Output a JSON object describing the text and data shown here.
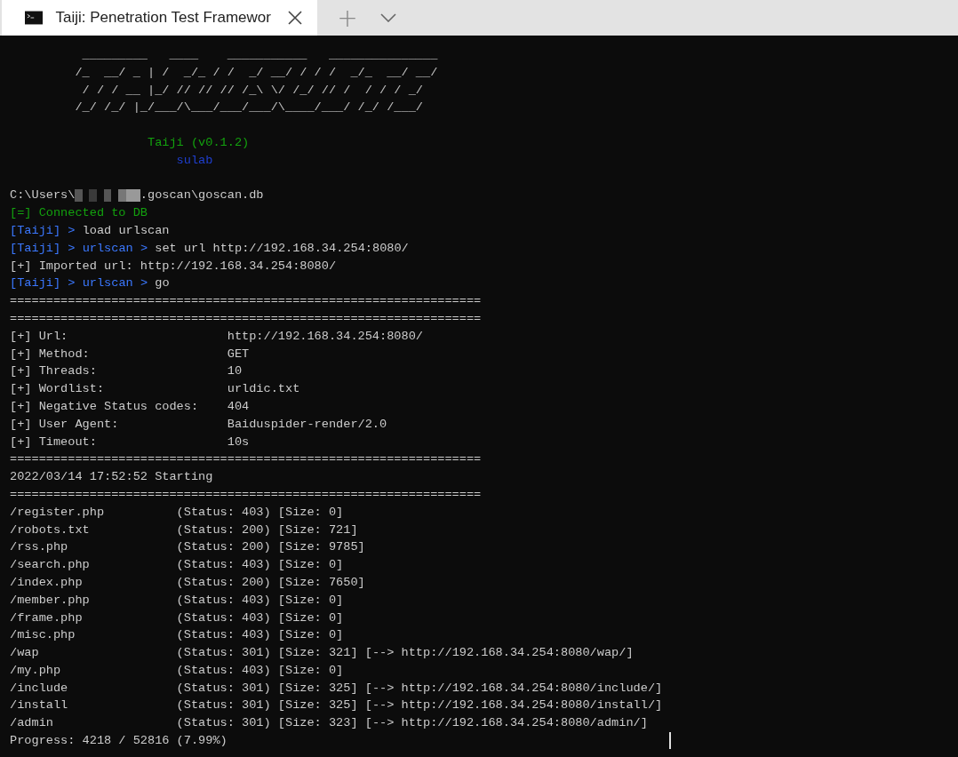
{
  "window": {
    "tabs": [
      {
        "title": "Taiji: Penetration Test Framewor",
        "selected": true
      }
    ],
    "new_tab": "+"
  },
  "terminal": {
    "lines": [
      {
        "kind": "art",
        "text": "  _________   ____    ___________   _______________"
      },
      {
        "kind": "art",
        "text": " /_  __/ _ | /  _/_ / /  _/ __/ / / /  _/_  __/ __/"
      },
      {
        "kind": "art",
        "text": "  / / / __ |_/ // // // /_\\ \\/ /_/ // /  / / / _/"
      },
      {
        "kind": "art",
        "text": " /_/ /_/ |_/___/\\___/___/___/\\____/___/ /_/ /___/"
      },
      {
        "kind": "blank"
      },
      {
        "kind": "title",
        "text": "Taiji (v0.1.2)"
      },
      {
        "kind": "author",
        "text": "sulab"
      },
      {
        "kind": "blank"
      },
      {
        "kind": "path",
        "prefix": "C:\\Users\\",
        "suffix": ".goscan\\goscan.db"
      },
      {
        "kind": "status",
        "text": "[=] Connected to DB"
      },
      {
        "kind": "prompt",
        "segments": [
          {
            "kind": "prompt",
            "text": "[Taiji]"
          },
          {
            "kind": "chevron",
            "text": ">"
          },
          {
            "kind": "command",
            "text": "load urlscan"
          }
        ]
      },
      {
        "kind": "prompt",
        "segments": [
          {
            "kind": "prompt",
            "text": "[Taiji]"
          },
          {
            "kind": "chevron",
            "text": ">"
          },
          {
            "kind": "module",
            "text": "urlscan"
          },
          {
            "kind": "chevron",
            "text": ">"
          },
          {
            "kind": "command",
            "text": "set url http://192.168.34.254:8080/"
          }
        ]
      },
      {
        "kind": "plain",
        "text": "[+] Imported url: http://192.168.34.254:8080/"
      },
      {
        "kind": "prompt",
        "segments": [
          {
            "kind": "prompt",
            "text": "[Taiji]"
          },
          {
            "kind": "chevron",
            "text": ">"
          },
          {
            "kind": "module",
            "text": "urlscan"
          },
          {
            "kind": "chevron",
            "text": ">"
          },
          {
            "kind": "command",
            "text": "go"
          }
        ]
      },
      {
        "kind": "rule",
        "text": "================================================================="
      },
      {
        "kind": "rule",
        "text": "================================================================="
      },
      {
        "kind": "field",
        "label": "[+] Url:",
        "value": "http://192.168.34.254:8080/"
      },
      {
        "kind": "field",
        "label": "[+] Method:",
        "value": "GET"
      },
      {
        "kind": "field",
        "label": "[+] Threads:",
        "value": "10"
      },
      {
        "kind": "field",
        "label": "[+] Wordlist:",
        "value": "urldic.txt"
      },
      {
        "kind": "field",
        "label": "[+] Negative Status codes:",
        "value": "404"
      },
      {
        "kind": "field",
        "label": "[+] User Agent:",
        "value": "Baiduspider-render/2.0"
      },
      {
        "kind": "field",
        "label": "[+] Timeout:",
        "value": "10s"
      },
      {
        "kind": "rule",
        "text": "================================================================="
      },
      {
        "kind": "plain",
        "text": "2022/03/14 17:52:52 Starting"
      },
      {
        "kind": "rule",
        "text": "================================================================="
      },
      {
        "kind": "result",
        "path": "/register.php",
        "info": "(Status: 403) [Size: 0]"
      },
      {
        "kind": "result",
        "path": "/robots.txt",
        "info": "(Status: 200) [Size: 721]"
      },
      {
        "kind": "result",
        "path": "/rss.php",
        "info": "(Status: 200) [Size: 9785]"
      },
      {
        "kind": "result",
        "path": "/search.php",
        "info": "(Status: 403) [Size: 0]"
      },
      {
        "kind": "result",
        "path": "/index.php",
        "info": "(Status: 200) [Size: 7650]"
      },
      {
        "kind": "result",
        "path": "/member.php",
        "info": "(Status: 403) [Size: 0]"
      },
      {
        "kind": "result",
        "path": "/frame.php",
        "info": "(Status: 403) [Size: 0]"
      },
      {
        "kind": "result",
        "path": "/misc.php",
        "info": "(Status: 403) [Size: 0]"
      },
      {
        "kind": "result",
        "path": "/wap",
        "info": "(Status: 301) [Size: 321]",
        "redirect": "[--> http://192.168.34.254:8080/wap/]"
      },
      {
        "kind": "result",
        "path": "/my.php",
        "info": "(Status: 403) [Size: 0]"
      },
      {
        "kind": "result",
        "path": "/include",
        "info": "(Status: 301) [Size: 325]",
        "redirect": "[--> http://192.168.34.254:8080/include/]"
      },
      {
        "kind": "result",
        "path": "/install",
        "info": "(Status: 301) [Size: 325]",
        "redirect": "[--> http://192.168.34.254:8080/install/]"
      },
      {
        "kind": "result",
        "path": "/admin",
        "info": "(Status: 301) [Size: 323]",
        "redirect": "[--> http://192.168.34.254:8080/admin/]"
      },
      {
        "kind": "progress",
        "text": "Progress: 4218 / 52816 (7.99%)"
      }
    ]
  }
}
